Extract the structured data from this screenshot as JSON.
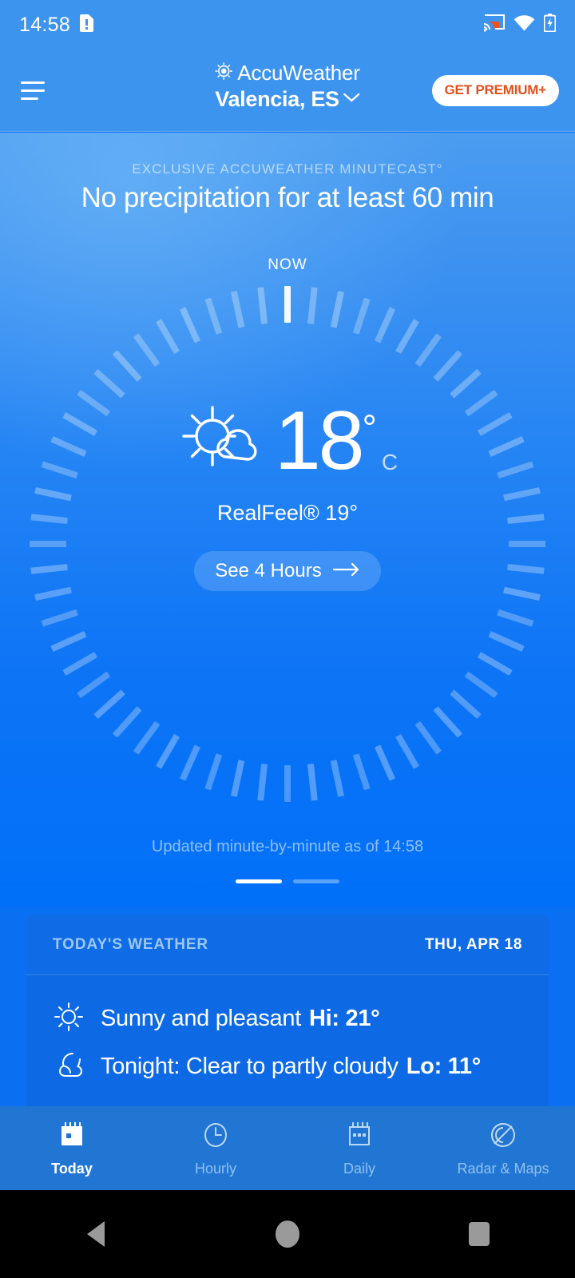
{
  "status_bar": {
    "clock": "14:58",
    "icons": [
      "sim-alert-icon",
      "cast-icon",
      "wifi-icon",
      "battery-charging-icon"
    ]
  },
  "header": {
    "menu_icon": "hamburger-menu-icon",
    "brand": "AccuWeather",
    "brand_icon": "accuweather-sun-logo-icon",
    "location": "Valencia, ES",
    "location_chevron": "chevron-down-icon",
    "premium_label": "GET PREMIUM+"
  },
  "minutecast": {
    "kicker": "EXCLUSIVE ACCUWEATHER MINUTECAST°",
    "headline": "No precipitation for at least 60 min",
    "now_label": "NOW",
    "temperature": "18",
    "degree": "°",
    "unit": "C",
    "condition_icon": "sun-behind-cloud-icon",
    "realfeel": "RealFeel® 19°",
    "see_hours_label": "See 4 Hours",
    "see_hours_icon": "arrow-right-icon",
    "updated": "Updated minute-by-minute as of 14:58",
    "pager": {
      "count": 2,
      "active_index": 0
    }
  },
  "today_card": {
    "title": "TODAY'S WEATHER",
    "date": "THU, APR 18",
    "rows": [
      {
        "icon": "sun-icon",
        "text": "Sunny and pleasant",
        "value": "Hi: 21°"
      },
      {
        "icon": "moon-cloud-icon",
        "text": "Tonight: Clear to partly cloudy",
        "value": "Lo: 11°"
      }
    ]
  },
  "bottom_nav": {
    "items": [
      {
        "label": "Today",
        "icon": "calendar-today-icon",
        "active": true
      },
      {
        "label": "Hourly",
        "icon": "clock-icon",
        "active": false
      },
      {
        "label": "Daily",
        "icon": "calendar-days-icon",
        "active": false
      },
      {
        "label": "Radar & Maps",
        "icon": "radar-icon",
        "active": false
      }
    ]
  },
  "system_nav": {
    "back": "back-triangle-icon",
    "home": "home-circle-icon",
    "recents": "recents-square-icon"
  },
  "colors": {
    "brand_blue": "#3d94ee",
    "hero_top": "#4a9cf0",
    "hero_bottom": "#0070f8",
    "card_blue": "#0e6ae4",
    "nav_blue": "#2176d4",
    "premium_orange": "#e1501e",
    "muted_text": "#9dc8f5"
  }
}
